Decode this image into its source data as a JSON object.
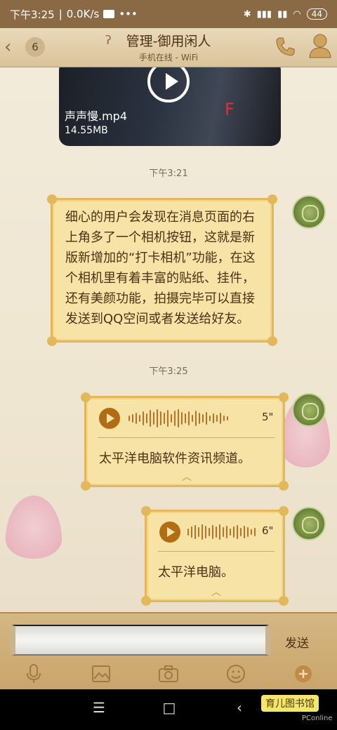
{
  "status": {
    "time": "下午3:25",
    "speed": "0.0K/s",
    "battery": "44"
  },
  "header": {
    "unread_count": "6",
    "title": "管理-御用闲人",
    "subtitle": "手机在线 - WiFi"
  },
  "video": {
    "filename": "声声慢.mp4",
    "size": "14.55MB",
    "logo_text": "F"
  },
  "messages": [
    {
      "timestamp": "下午3:21",
      "text": "细心的用户会发现在消息页面的右上角多了一个相机按钮，这就是新版新增加的“打卡相机”功能，在这个相机里有着丰富的贴纸、挂件，还有美颜功能，拍摄完毕可以直接发送到QQ空间或者发送给好友。"
    },
    {
      "timestamp": "下午3:25",
      "duration": "5\"",
      "transcript": "太平洋电脑软件资讯频道。"
    },
    {
      "duration": "6\"",
      "transcript": "太平洋电脑。"
    }
  ],
  "input": {
    "send_label": "发送"
  },
  "watermark": {
    "site": "育儿图书馆",
    "brand": "PConline"
  },
  "colors": {
    "bubble": "#f7e3a6",
    "bubble_border": "#e2b85a",
    "accent": "#b26c14"
  }
}
